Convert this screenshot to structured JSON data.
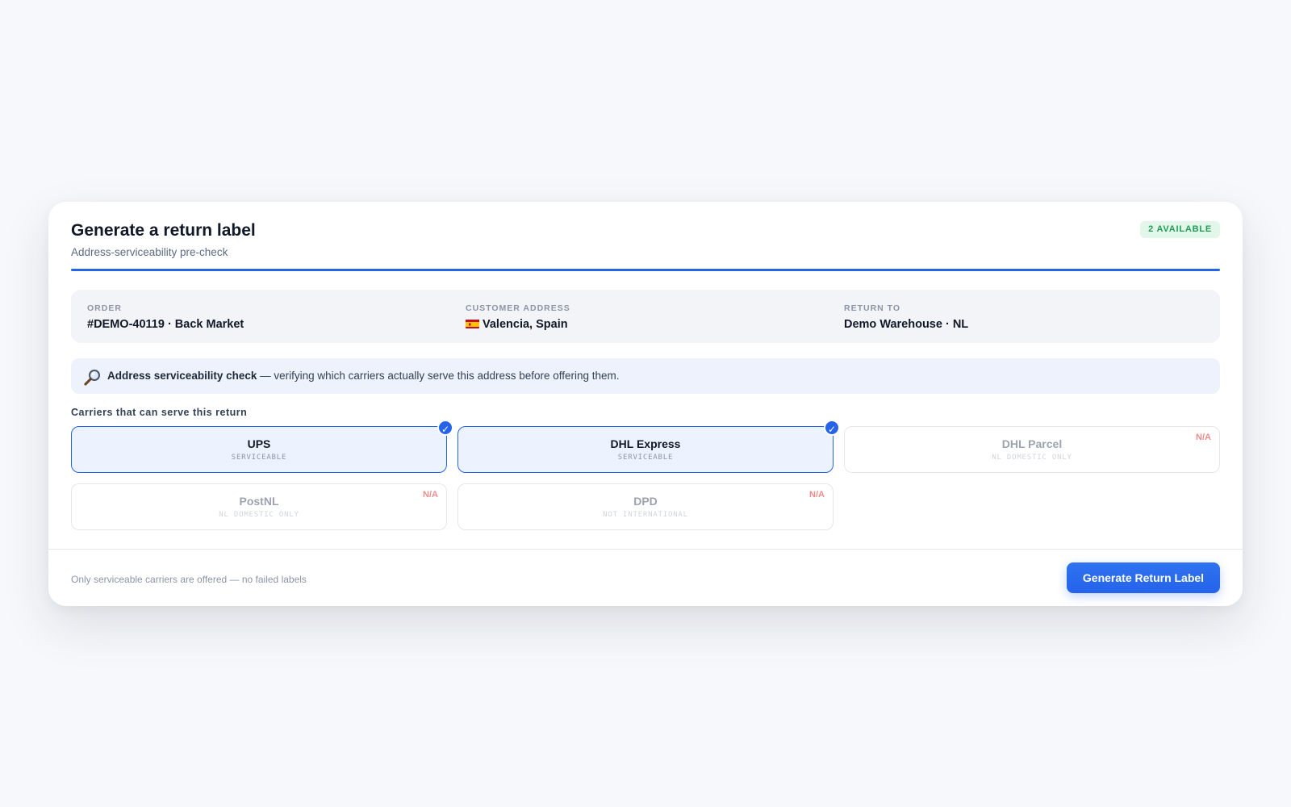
{
  "header": {
    "title": "Generate a return label",
    "subtitle": "Address-serviceability pre-check",
    "badge": "2 AVAILABLE"
  },
  "order_info": {
    "order": {
      "label": "ORDER",
      "value": "#DEMO-40119 · Back Market"
    },
    "customer_address": {
      "label": "CUSTOMER ADDRESS",
      "value": "Valencia, Spain",
      "flag_icon": "spain-flag-icon"
    },
    "return_to": {
      "label": "RETURN TO",
      "value": "Demo Warehouse · NL"
    }
  },
  "check_banner": {
    "icon": "magnifier-icon",
    "strong": "Address serviceability check",
    "text": " — verifying which carriers actually serve this address before offering them."
  },
  "carriers_section": {
    "label": "Carriers that can serve this return",
    "carriers": [
      {
        "name": "UPS",
        "status": "SERVICEABLE",
        "serviceable": true
      },
      {
        "name": "DHL Express",
        "status": "SERVICEABLE",
        "serviceable": true
      },
      {
        "name": "DHL Parcel",
        "status": "NL DOMESTIC ONLY",
        "serviceable": false,
        "tag": "N/A"
      },
      {
        "name": "PostNL",
        "status": "NL DOMESTIC ONLY",
        "serviceable": false,
        "tag": "N/A"
      },
      {
        "name": "DPD",
        "status": "NOT INTERNATIONAL",
        "serviceable": false,
        "tag": "N/A"
      }
    ]
  },
  "footer": {
    "note": "Only serviceable carriers are offered — no failed labels",
    "button_label": "Generate Return Label"
  },
  "colors": {
    "accent": "#2563eb",
    "success": "#1f9d55",
    "unavailable": "#f08c8c"
  }
}
